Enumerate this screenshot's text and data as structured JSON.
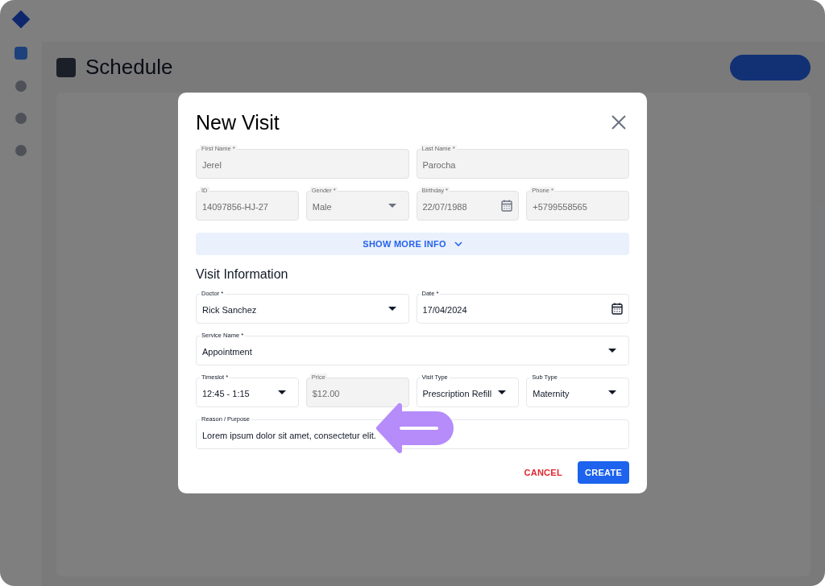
{
  "background": {
    "page_title": "Schedule"
  },
  "dialog": {
    "title": "New Visit",
    "patient_rows": [
      [
        {
          "label": "First Name *",
          "value": "Jerel",
          "kind": "text",
          "disabled": true
        },
        {
          "label": "Last Name *",
          "value": "Parocha",
          "kind": "text",
          "disabled": true
        }
      ],
      [
        {
          "label": "ID",
          "value": "14097856-HJ-27",
          "kind": "text",
          "disabled": true
        },
        {
          "label": "Gender *",
          "value": "Male",
          "kind": "select",
          "disabled": true
        },
        {
          "label": "Birthday *",
          "value": "22/07/1988",
          "kind": "date",
          "disabled": true
        },
        {
          "label": "Phone *",
          "value": "+5799558565",
          "kind": "text",
          "disabled": true
        }
      ]
    ],
    "more_button": {
      "label": "SHOW MORE INFO",
      "expanded": false
    },
    "section_title": "Visit Information",
    "visit_rows": [
      [
        {
          "label": "Doctor *",
          "value": "Rick Sanchez",
          "kind": "select",
          "disabled": false
        },
        {
          "label": "Date *",
          "value": "17/04/2024",
          "kind": "date",
          "disabled": false
        }
      ],
      [
        {
          "label": "Service Name *",
          "value": "Appointment",
          "kind": "select",
          "disabled": false
        }
      ],
      [
        {
          "label": "Timeslot *",
          "value": "12:45 - 1:15",
          "kind": "select",
          "disabled": false
        },
        {
          "label": "Price",
          "value": "$12.00",
          "kind": "text",
          "disabled": true
        },
        {
          "label": "Visit Type",
          "value": "Prescription Refill",
          "kind": "select",
          "disabled": false
        },
        {
          "label": "Sub Type",
          "value": "Maternity",
          "kind": "select",
          "disabled": false
        }
      ],
      [
        {
          "label": "Reason / Purpose",
          "value": "Lorem ipsum dolor sit amet, consectetur elit.",
          "kind": "text",
          "disabled": false
        }
      ]
    ],
    "buttons": [
      {
        "label": "CANCEL",
        "kind": "text"
      },
      {
        "label": "CREATE",
        "kind": "primary"
      }
    ]
  }
}
